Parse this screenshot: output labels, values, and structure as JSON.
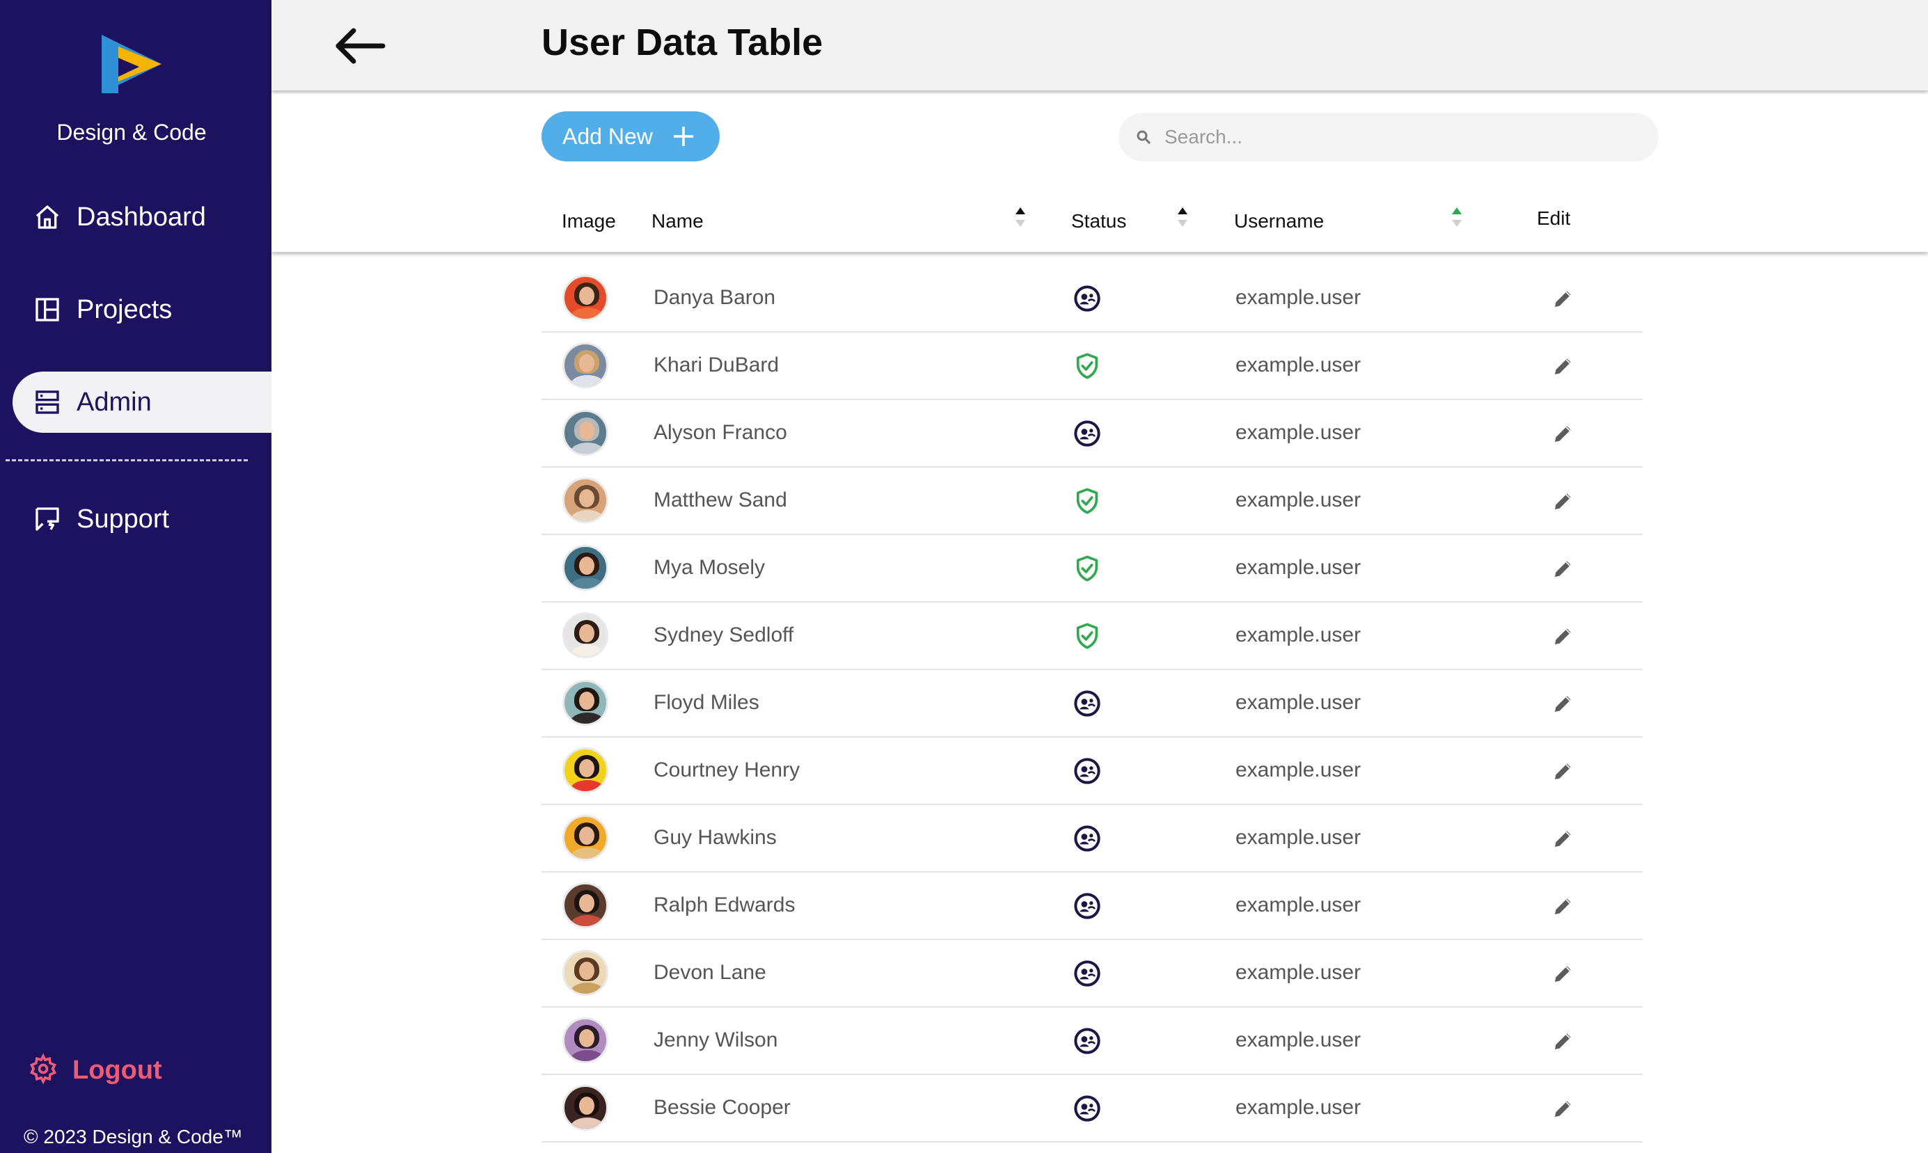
{
  "sidebar": {
    "brand": "Design & Code",
    "items": [
      {
        "label": "Dashboard",
        "icon": "home-icon"
      },
      {
        "label": "Projects",
        "icon": "layout-icon"
      },
      {
        "label": "Admin",
        "icon": "server-icon",
        "active": true
      },
      {
        "label": "Support",
        "icon": "chat-icon"
      }
    ],
    "logout": "Logout",
    "copyright": "© 2023 Design & Code™"
  },
  "header": {
    "title": "User Data Table"
  },
  "toolbar": {
    "add_label": "Add New",
    "search_placeholder": "Search..."
  },
  "table": {
    "columns": [
      "Image",
      "Name",
      "Status",
      "Username",
      "Edit"
    ],
    "rows": [
      {
        "name": "Danya Baron",
        "status": "user",
        "username": "example.user"
      },
      {
        "name": "Khari DuBard",
        "status": "verified",
        "username": "example.user"
      },
      {
        "name": "Alyson Franco",
        "status": "user",
        "username": "example.user"
      },
      {
        "name": "Matthew Sand",
        "status": "verified",
        "username": "example.user"
      },
      {
        "name": "Mya Mosely",
        "status": "verified",
        "username": "example.user"
      },
      {
        "name": "Sydney Sedloff",
        "status": "verified",
        "username": "example.user"
      },
      {
        "name": "Floyd Miles",
        "status": "user",
        "username": "example.user"
      },
      {
        "name": "Courtney Henry",
        "status": "user",
        "username": "example.user"
      },
      {
        "name": "Guy Hawkins",
        "status": "user",
        "username": "example.user"
      },
      {
        "name": "Ralph Edwards",
        "status": "user",
        "username": "example.user"
      },
      {
        "name": "Devon Lane",
        "status": "user",
        "username": "example.user"
      },
      {
        "name": "Jenny Wilson",
        "status": "user",
        "username": "example.user"
      },
      {
        "name": "Bessie Cooper",
        "status": "user",
        "username": "example.user"
      }
    ]
  },
  "colors": {
    "sidebar_bg": "#1d1260",
    "accent_blue": "#52aee9",
    "logout_pink": "#ee5b74",
    "verified_green": "#2fa84f",
    "sort_active_green": "#2fa84f"
  }
}
